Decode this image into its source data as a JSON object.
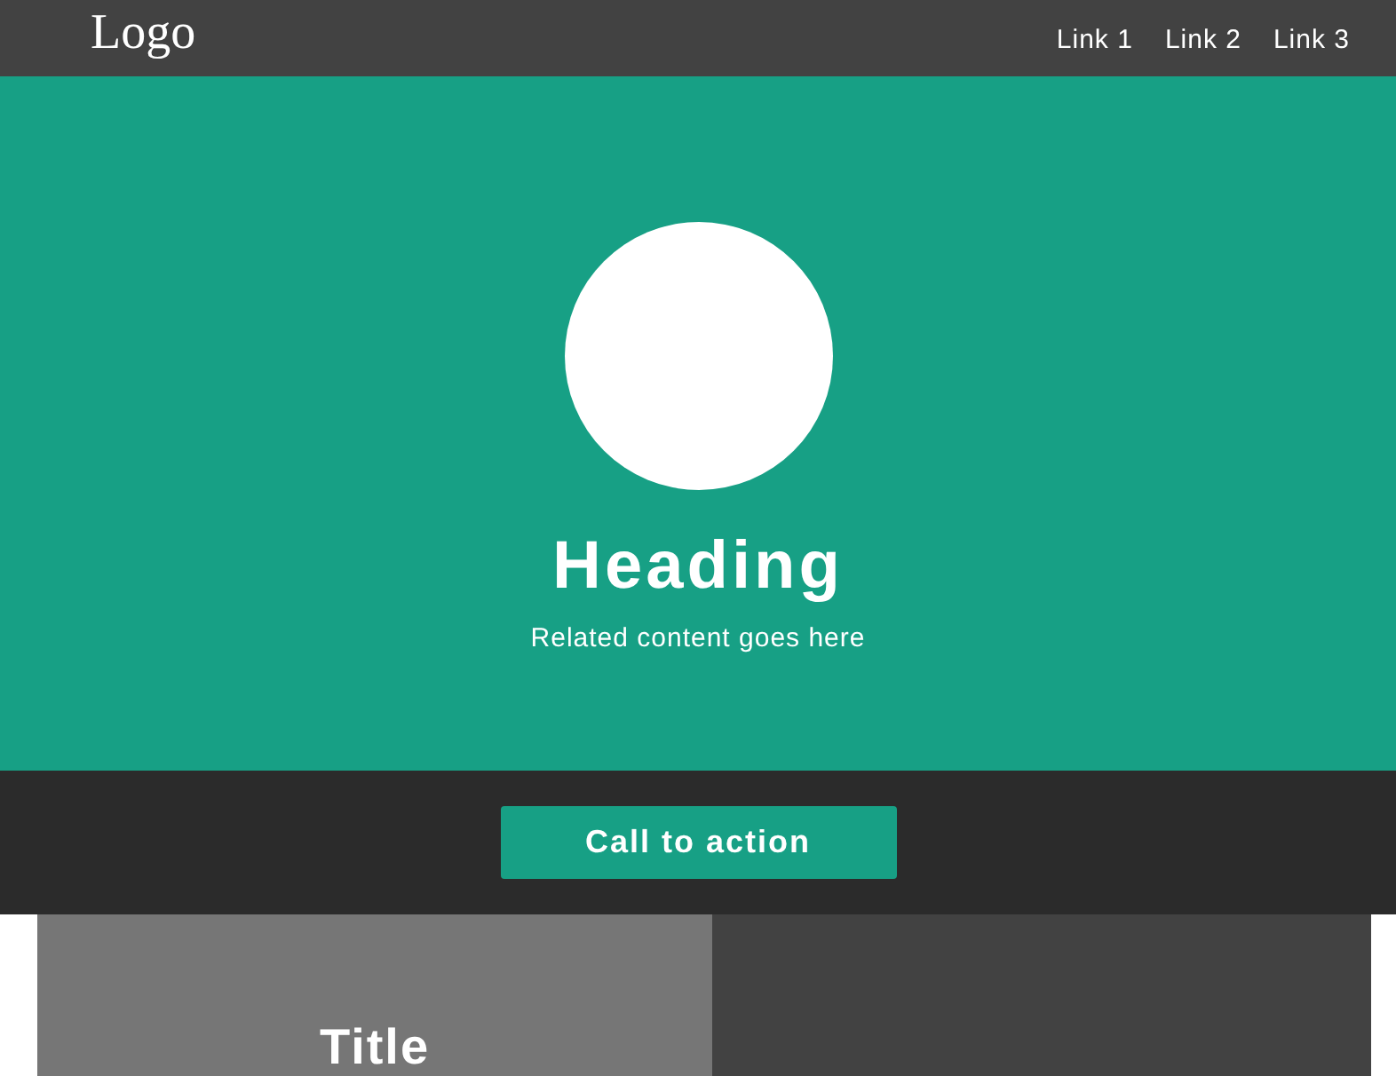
{
  "navbar": {
    "logo": "Logo",
    "links": [
      "Link 1",
      "Link 2",
      "Link 3"
    ]
  },
  "hero": {
    "heading": "Heading",
    "subtext": "Related content goes here"
  },
  "cta": {
    "label": "Call to action"
  },
  "cards": [
    {
      "title": "Title"
    }
  ]
}
